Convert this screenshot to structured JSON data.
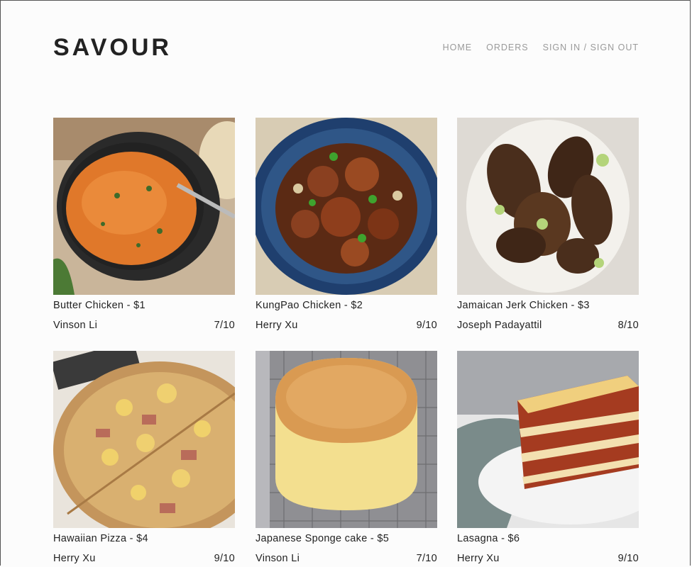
{
  "brand": {
    "logo": "SAVOUR"
  },
  "nav": {
    "home": "HOME",
    "orders": "ORDERS",
    "signin": "SIGN IN / SIGN OUT"
  },
  "dishes": [
    {
      "title": "Butter Chicken - $1",
      "author": "Vinson Li",
      "rating": "7/10"
    },
    {
      "title": "KungPao Chicken - $2",
      "author": "Herry Xu",
      "rating": "9/10"
    },
    {
      "title": "Jamaican Jerk Chicken - $3",
      "author": "Joseph Padayattil",
      "rating": "8/10"
    },
    {
      "title": "Hawaiian Pizza - $4",
      "author": "Herry Xu",
      "rating": "9/10"
    },
    {
      "title": "Japanese Sponge cake - $5",
      "author": "Vinson Li",
      "rating": "7/10"
    },
    {
      "title": "Lasagna - $6",
      "author": "Herry Xu",
      "rating": "9/10"
    }
  ]
}
